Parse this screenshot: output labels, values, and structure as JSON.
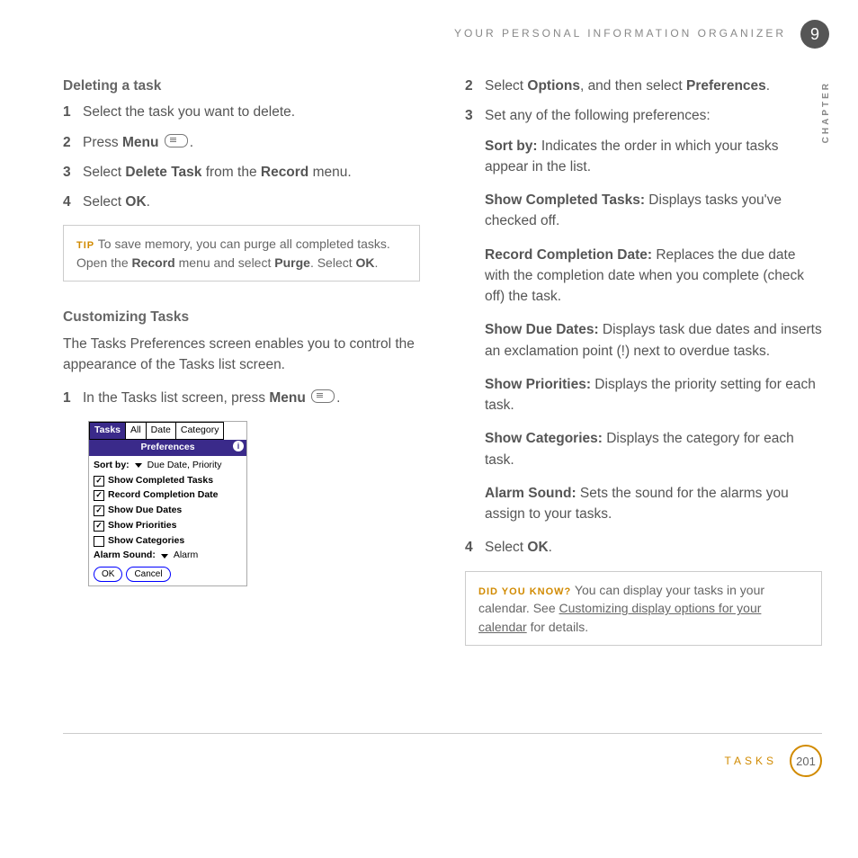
{
  "header": {
    "title": "YOUR PERSONAL INFORMATION ORGANIZER",
    "chapter_number": "9",
    "chapter_label": "CHAPTER"
  },
  "left": {
    "h1": "Deleting a task",
    "steps_a": {
      "s1": "Select the task you want to delete.",
      "s2_pre": "Press ",
      "s2_bold": "Menu",
      "s3_pre": "Select ",
      "s3_b1": "Delete Task",
      "s3_mid": " from the ",
      "s3_b2": "Record",
      "s3_post": " menu.",
      "s4_pre": "Select ",
      "s4_b": "OK",
      "s4_post": "."
    },
    "tip": {
      "label": "TIP",
      "t1": " To save memory, you can purge all completed tasks. Open the ",
      "b1": "Record",
      "t2": " menu and select ",
      "b2": "Purge",
      "t3": ". Select ",
      "b3": "OK",
      "t4": "."
    },
    "h2": "Customizing Tasks",
    "intro": "The Tasks Preferences screen enables you to control the appearance of the Tasks list screen.",
    "step1_pre": "In the Tasks list screen, press ",
    "step1_b": "Menu",
    "device": {
      "tab1": "Tasks",
      "tab2": "All",
      "tab3": "Date",
      "tab4": "Category",
      "title": "Preferences",
      "sortby_label": "Sort by:",
      "sortby_value": "Due Date, Priority",
      "opt1": "Show Completed Tasks",
      "opt2": "Record Completion Date",
      "opt3": "Show Due Dates",
      "opt4": "Show Priorities",
      "opt5": "Show Categories",
      "alarm_label": "Alarm Sound:",
      "alarm_value": "Alarm",
      "ok": "OK",
      "cancel": "Cancel"
    }
  },
  "right": {
    "s2_pre": "Select ",
    "s2_b1": "Options",
    "s2_mid": ", and then select ",
    "s2_b2": "Preferences",
    "s2_post": ".",
    "s3": "Set any of the following preferences:",
    "prefs": {
      "p1_b": "Sort by:",
      "p1_t": " Indicates the order in which your tasks appear in the list.",
      "p2_b": "Show Completed Tasks:",
      "p2_t": " Displays tasks you've checked off.",
      "p3_b": "Record Completion Date:",
      "p3_t": " Replaces the due date with the completion date when you complete (check off) the task.",
      "p4_b": "Show Due Dates:",
      "p4_t": " Displays task due dates and inserts an exclamation point (!) next to overdue tasks.",
      "p5_b": "Show Priorities:",
      "p5_t": " Displays the priority setting for each task.",
      "p6_b": "Show Categories:",
      "p6_t": " Displays the category for each task.",
      "p7_b": "Alarm Sound:",
      "p7_t": " Sets the sound for the alarms you assign to your tasks."
    },
    "s4_pre": "Select ",
    "s4_b": "OK",
    "s4_post": ".",
    "dyk": {
      "label": "DID YOU KNOW?",
      "t1": " You can display your tasks in your calendar. See ",
      "link": "Customizing display options for your calendar",
      "t2": " for details."
    }
  },
  "footer": {
    "section": "TASKS",
    "page": "201"
  }
}
